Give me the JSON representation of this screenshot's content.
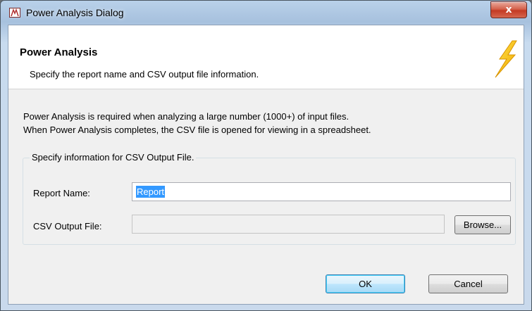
{
  "window": {
    "title": "Power Analysis Dialog",
    "close_glyph": "x"
  },
  "header": {
    "title": "Power Analysis",
    "subtitle": "Specify the report name and CSV output file information.",
    "icon": "lightning-bolt-icon"
  },
  "info": {
    "line1": "Power Analysis is required when analyzing a large number (1000+) of input files.",
    "line2": "When Power Analysis completes, the CSV file is opened for viewing in a spreadsheet."
  },
  "group": {
    "legend": "Specify information for CSV Output File.",
    "report_name_label": "Report Name:",
    "report_name_value": "Report",
    "csv_label": "CSV Output File:",
    "csv_value": "",
    "browse_label": "Browse..."
  },
  "buttons": {
    "ok": "OK",
    "cancel": "Cancel"
  },
  "colors": {
    "selection": "#3399ff",
    "bolt": "#f5c518",
    "close": "#c33a23"
  }
}
